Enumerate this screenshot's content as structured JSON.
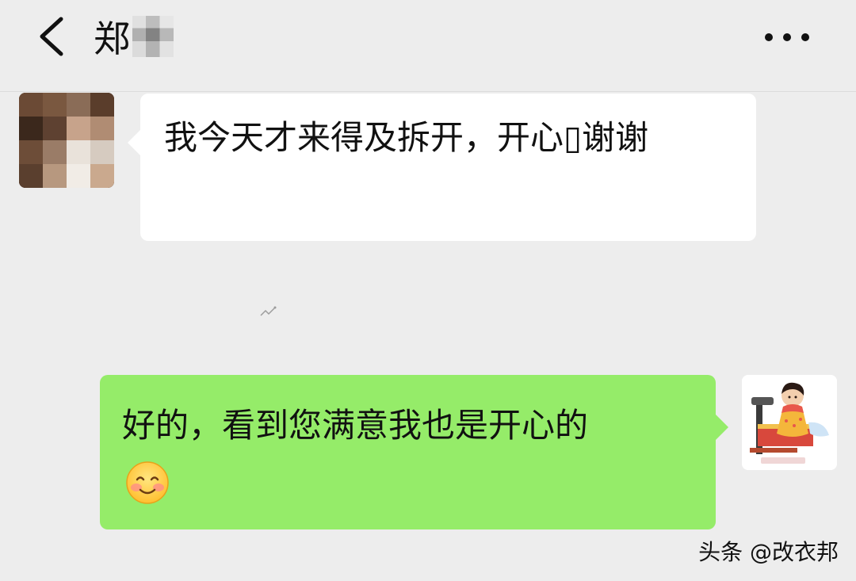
{
  "header": {
    "title": "郑",
    "back_icon": "chevron-left-icon",
    "more_icon": "more-dots-icon"
  },
  "messages": [
    {
      "side": "left",
      "text": "我今天才来得及拆开，开心\u0000谢谢",
      "display_text": "我今天才来得及拆开，开心▯谢谢",
      "avatar": "avatar-blurred-person"
    },
    {
      "side": "right",
      "text": "好的，看到您满意我也是开心的",
      "emoji": "smiling-face-icon",
      "avatar": "avatar-sewing-girl-cartoon"
    }
  ],
  "watermark": {
    "text": "头条 @改衣邦"
  },
  "colors": {
    "background": "#ededed",
    "incoming_bubble": "#ffffff",
    "outgoing_bubble": "#95ec69"
  }
}
